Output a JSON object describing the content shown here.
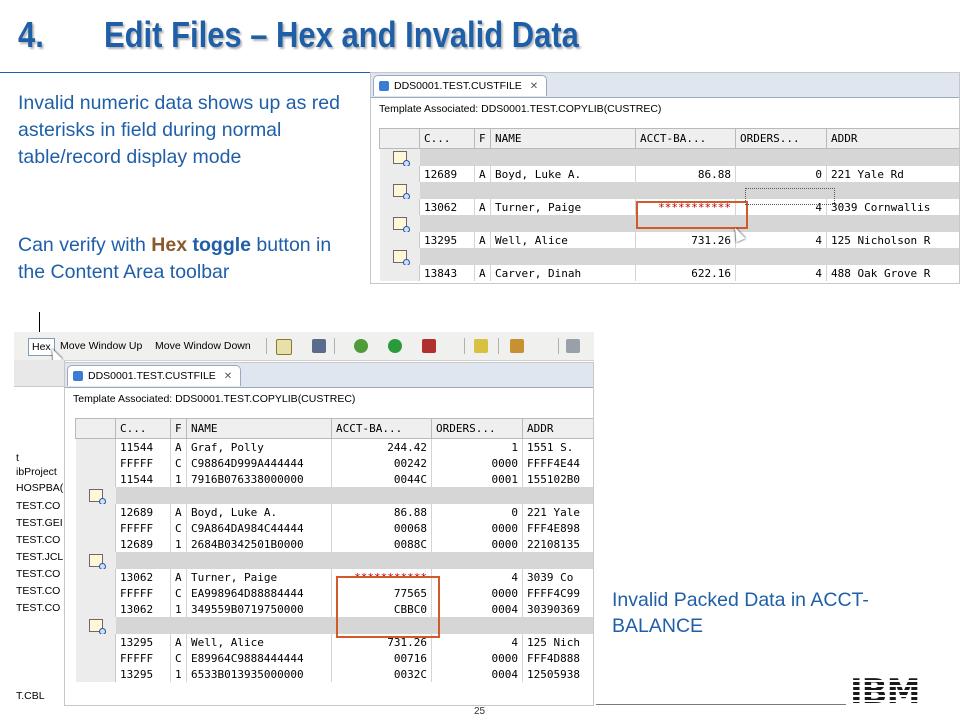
{
  "slide": {
    "number": "4.",
    "title": "Edit Files – Hex and Invalid Data",
    "page_number": "25",
    "logo_text": "IBM",
    "colors": {
      "title": "#1f5fa8",
      "invalid": "#c00000",
      "highlight": "#d05a2a"
    }
  },
  "bullets": {
    "first": "Invalid numeric data shows up as red asterisks in field during normal table/record display mode",
    "second_pre": "Can verify with ",
    "second_hex": "Hex",
    "second_toggle": "toggle",
    "second_post": "button in the Content Area toolbar"
  },
  "caption": "Invalid Packed Data in ACCT-BALANCE",
  "toolbar": {
    "hex_label": "Hex",
    "move_up_label": "Move Window Up",
    "move_down_label": "Move Window Down"
  },
  "left_pane": {
    "items": [
      "t",
      "ibProject",
      "HOSPBA(",
      "TEST.CO",
      "TEST.GEI",
      "TEST.CO",
      "TEST.JCL",
      "TEST.CO",
      "TEST.CO",
      "TEST.CO",
      "T.CBL"
    ]
  },
  "editor_top": {
    "tab_label": "DDS0001.TEST.CUSTFILE",
    "template_label": "Template Associated: DDS0001.TEST.COPYLIB(CUSTREC)",
    "columns": [
      "C...",
      "F",
      "NAME",
      "ACCT-BA...",
      "ORDERS...",
      "ADDR"
    ],
    "rows": [
      [
        "12689",
        "A",
        "Boyd, Luke A.",
        "86.88",
        "0",
        "221 Yale Rd"
      ],
      [
        "13062",
        "A",
        "Turner, Paige",
        "***********",
        "4",
        "3039 Cornwallis"
      ],
      [
        "13295",
        "A",
        "Well, Alice",
        "731.26",
        "4",
        "125 Nicholson R"
      ],
      [
        "13843",
        "A",
        "Carver, Dinah",
        "622.16",
        "4",
        "488 Oak Grove R"
      ]
    ]
  },
  "editor_bottom": {
    "tab_label": "DDS0001.TEST.CUSTFILE",
    "template_label": "Template Associated: DDS0001.TEST.COPYLIB(CUSTREC)",
    "columns": [
      "C...",
      "F",
      "NAME",
      "ACCT-BA...",
      "ORDERS...",
      "ADDR"
    ],
    "groups": [
      [
        [
          "11544",
          "A",
          "Graf, Polly",
          "244.42",
          "1",
          "1551 S."
        ],
        [
          "FFFFF",
          "C",
          "C98864D999A444444",
          "00242",
          "0000",
          "FFFF4E44"
        ],
        [
          "11544",
          "1",
          "7916B076338000000",
          "0044C",
          "0001",
          "155102B0"
        ]
      ],
      [
        [
          "12689",
          "A",
          "Boyd, Luke A.",
          "86.88",
          "0",
          "221 Yale"
        ],
        [
          "FFFFF",
          "C",
          "C9A864DA984C44444",
          "00068",
          "0000",
          "FFF4E898"
        ],
        [
          "12689",
          "1",
          "2684B0342501B0000",
          "0088C",
          "0000",
          "22108135"
        ]
      ],
      [
        [
          "13062",
          "A",
          "Turner, Paige",
          "***********",
          "4",
          "3039 Co"
        ],
        [
          "FFFFF",
          "C",
          "EA998964D88884444",
          "77565",
          "0000",
          "FFFF4C99"
        ],
        [
          "13062",
          "1",
          "349559B0719750000",
          "CBBC0",
          "0004",
          "30390369"
        ]
      ],
      [
        [
          "13295",
          "A",
          "Well, Alice",
          "731.26",
          "4",
          "125 Nich"
        ],
        [
          "FFFFF",
          "C",
          "E89964C9888444444",
          "00716",
          "0000",
          "FFF4D888"
        ],
        [
          "13295",
          "1",
          "6533B013935000000",
          "0032C",
          "0004",
          "12505938"
        ]
      ]
    ]
  }
}
